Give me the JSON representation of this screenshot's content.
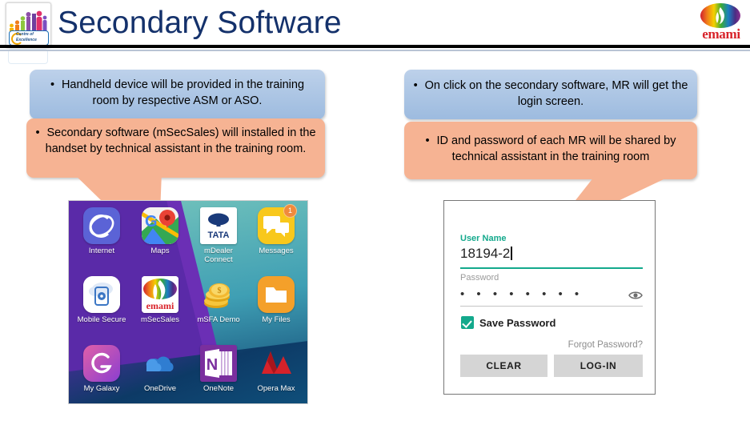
{
  "header": {
    "title": "Secondary Software",
    "left_logo": {
      "name": "centre-of-excellence-logo",
      "line1": "Centre of",
      "line2": "Excellence"
    },
    "right_logo": {
      "name": "emami-logo",
      "wordmark": "emami"
    }
  },
  "callouts": {
    "left_blue": {
      "bullet": "•",
      "text": "Handheld device will be provided in the training room by respective ASM or ASO.",
      "color": "#9dbbdf"
    },
    "left_peach": {
      "bullet": "•",
      "text": "Secondary software (mSecSales) will installed in the handset by technical assistant in the training room.",
      "color": "#f6b393"
    },
    "right_blue": {
      "bullet": "•",
      "text": "On click on the secondary software, MR will get the login screen.",
      "color": "#9dbbdf"
    },
    "right_peach": {
      "bullet": "•",
      "text": "ID and password of each MR will be shared by technical assistant in the training room",
      "color": "#f6b393"
    }
  },
  "phone": {
    "apps": [
      {
        "label": "Internet",
        "icon": "internet-icon",
        "badge": null
      },
      {
        "label": "Maps",
        "icon": "maps-icon",
        "badge": null
      },
      {
        "label": "mDealer\nConnect",
        "icon": "tata-mdealer-icon",
        "badge": null
      },
      {
        "label": "Messages",
        "icon": "messages-icon",
        "badge": "1"
      },
      {
        "label": "Mobile Secure",
        "icon": "mobile-secure-icon",
        "badge": null
      },
      {
        "label": "mSecSales",
        "icon": "msecsales-emami-icon",
        "badge": null
      },
      {
        "label": "mSFA Demo",
        "icon": "msfa-demo-coins-icon",
        "badge": null
      },
      {
        "label": "My Files",
        "icon": "my-files-folder-icon",
        "badge": null
      },
      {
        "label": "My Galaxy",
        "icon": "my-galaxy-icon",
        "badge": null
      },
      {
        "label": "OneDrive",
        "icon": "onedrive-icon",
        "badge": null
      },
      {
        "label": "OneNote",
        "icon": "onenote-icon",
        "badge": null
      },
      {
        "label": "Opera Max",
        "icon": "opera-max-icon",
        "badge": null
      }
    ]
  },
  "login": {
    "username_label": "User Name",
    "username_value": "18194-2",
    "password_label": "Password",
    "password_value": "• • • • • • • •",
    "show_password_icon": "eye-icon",
    "save_password_label": "Save Password",
    "save_password_checked": true,
    "forgot_password_label": "Forgot Password?",
    "clear_button": "CLEAR",
    "login_button": "LOG-IN",
    "accent_color": "#13a98c",
    "button_color": "#d5d5d5"
  }
}
